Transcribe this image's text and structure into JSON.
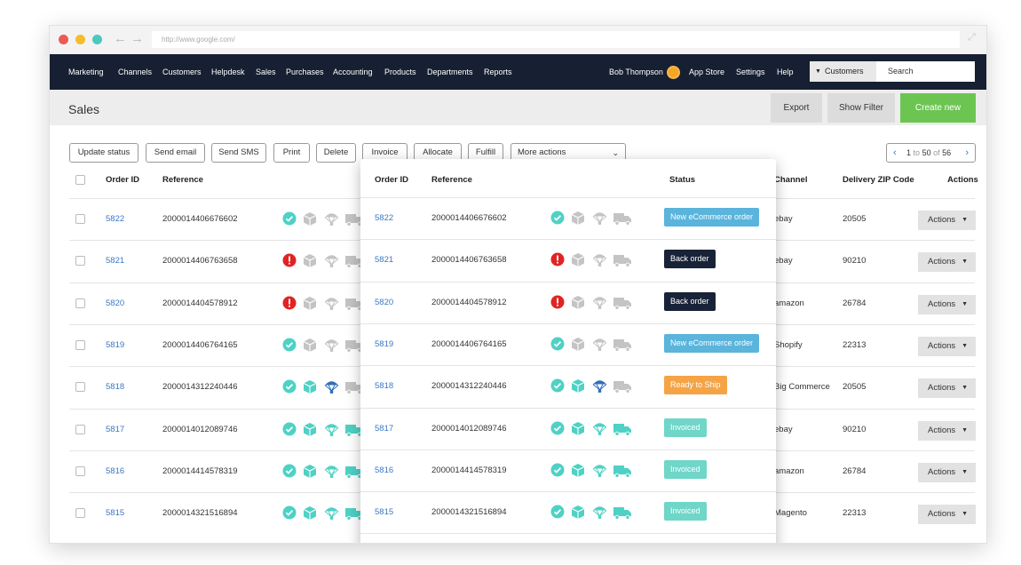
{
  "browser": {
    "url": "http://www.google.com/"
  },
  "nav": {
    "items": [
      "Marketing",
      "Channels",
      "Customers",
      "Helpdesk",
      "Sales",
      "Purchases",
      "Accounting",
      "Products",
      "Departments",
      "Reports"
    ],
    "user": "Bob Thompson",
    "app_store": "App Store",
    "settings": "Settings",
    "help": "Help",
    "search_scope": "Customers",
    "search_placeholder": "Search"
  },
  "page": {
    "title": "Sales",
    "export_label": "Export",
    "show_filter_label": "Show Filter",
    "create_new_label": "Create new"
  },
  "toolbar": {
    "buttons": [
      "Update status",
      "Send email",
      "Send SMS",
      "Print",
      "Delete",
      "Invoice",
      "Allocate",
      "Fulfill"
    ],
    "more_actions": "More actions"
  },
  "pager": {
    "from": "1",
    "to_word": "to",
    "to": "50",
    "of_word": "of",
    "total": "56"
  },
  "table": {
    "headers": {
      "order_id": "Order ID",
      "reference": "Reference",
      "status": "Status",
      "channel": "Channel",
      "zip": "Delivery ZIP Code",
      "actions": "Actions"
    },
    "action_label": "Actions",
    "rows": [
      {
        "order_id": "5822",
        "reference": "2000014406676602",
        "status": "New eCommerce order",
        "channel": "ebay",
        "zip": "20505",
        "first": "ok"
      },
      {
        "order_id": "5821",
        "reference": "2000014406763658",
        "status": "Back order",
        "channel": "ebay",
        "zip": "90210",
        "first": "alert"
      },
      {
        "order_id": "5820",
        "reference": "2000014404578912",
        "status": "Back order",
        "channel": "amazon",
        "zip": "26784",
        "first": "alert"
      },
      {
        "order_id": "5819",
        "reference": "2000014406764165",
        "status": "New eCommerce order",
        "channel": "Shopify",
        "zip": "22313",
        "first": "ok"
      },
      {
        "order_id": "5818",
        "reference": "2000014312240446",
        "status": "Ready to Ship",
        "channel": "Big Commerce",
        "zip": "20505",
        "first": "ok"
      },
      {
        "order_id": "5817",
        "reference": "2000014012089746",
        "status": "Invoiced",
        "channel": "ebay",
        "zip": "90210",
        "first": "ok"
      },
      {
        "order_id": "5816",
        "reference": "2000014414578319",
        "status": "Invoiced",
        "channel": "amazon",
        "zip": "26784",
        "first": "ok"
      },
      {
        "order_id": "5815",
        "reference": "2000014321516894",
        "status": "Invoiced",
        "channel": "Magento",
        "zip": "22313",
        "first": "ok"
      }
    ]
  },
  "colors": {
    "nav_bg": "#172032",
    "create_green": "#6cc551",
    "link_blue": "#3a78c2",
    "teal": "#4fd1c5",
    "alert_red": "#e02424",
    "status_new": "#5ab4dc",
    "status_back": "#182338",
    "status_ready": "#f5a445",
    "status_invoiced": "#6fd6c8"
  }
}
